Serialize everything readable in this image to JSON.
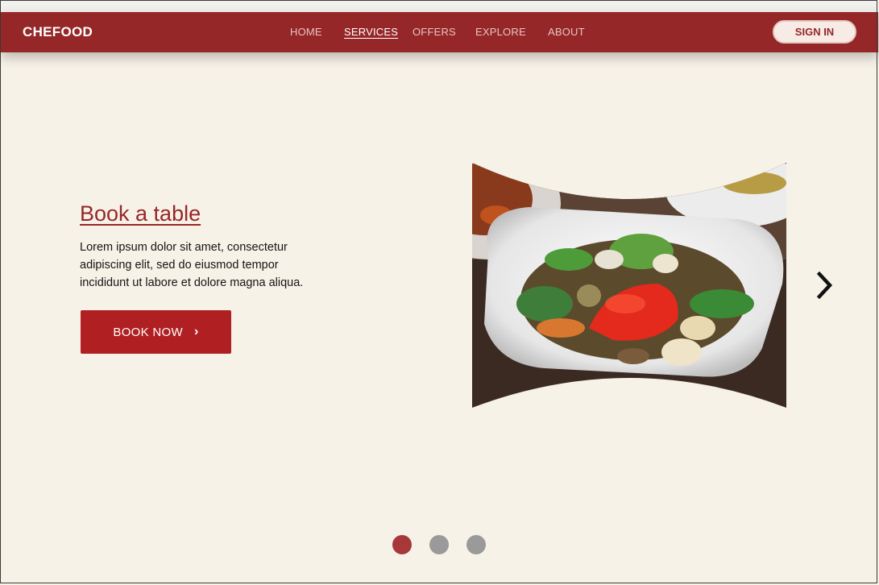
{
  "brand": "CHEFOOD",
  "nav": {
    "items": [
      {
        "label": "HOME",
        "active": false
      },
      {
        "label": "SERVICES",
        "active": true
      },
      {
        "label": "OFFERS",
        "active": false
      },
      {
        "label": "EXPLORE",
        "active": false
      },
      {
        "label": "ABOUT",
        "active": false
      }
    ],
    "sign_in_label": "SIGN IN"
  },
  "hero": {
    "title": "Book a table",
    "text": "Lorem ipsum dolor sit amet, consectetur adipiscing elit, sed do eiusmod tempor incididunt ut labore et dolore magna aliqua.",
    "button_label": "BOOK NOW",
    "button_icon": "chevron-right-icon",
    "image": "stir-fry-dish-photo"
  },
  "carousel": {
    "next_icon": "chevron-right-icon",
    "slide_count": 3,
    "active_index": 0
  },
  "colors": {
    "brand": "#962728",
    "button": "#b02023",
    "background": "#f7f2e8",
    "dot_active": "#a6383a",
    "dot_inactive": "#9a9a9a"
  }
}
